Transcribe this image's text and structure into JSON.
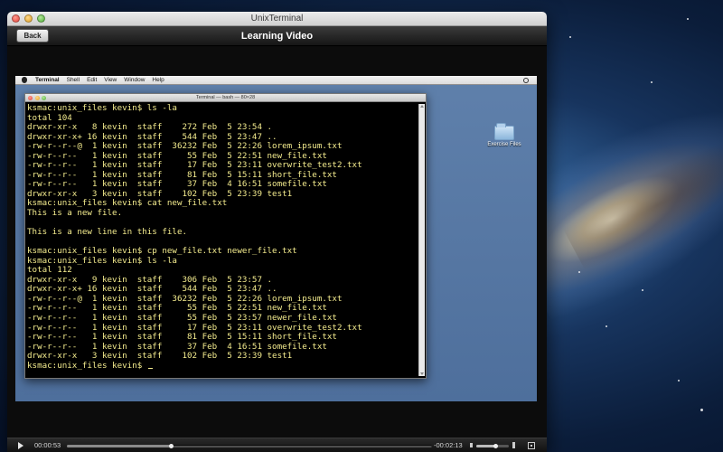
{
  "window": {
    "title": "UnixTerminal"
  },
  "navbar": {
    "back_label": "Back",
    "title": "Learning Video"
  },
  "video": {
    "menubar": {
      "app_name": "Terminal",
      "items": [
        "Shell",
        "Edit",
        "View",
        "Window",
        "Help"
      ]
    },
    "terminal": {
      "title": "Terminal — bash — 80×28",
      "lines": [
        "ksmac:unix_files kevin$ ls -la",
        "total 104",
        "drwxr-xr-x   8 kevin  staff    272 Feb  5 23:54 .",
        "drwxr-xr-x+ 16 kevin  staff    544 Feb  5 23:47 ..",
        "-rw-r--r--@  1 kevin  staff  36232 Feb  5 22:26 lorem_ipsum.txt",
        "-rw-r--r--   1 kevin  staff     55 Feb  5 22:51 new_file.txt",
        "-rw-r--r--   1 kevin  staff     17 Feb  5 23:11 overwrite_test2.txt",
        "-rw-r--r--   1 kevin  staff     81 Feb  5 15:11 short_file.txt",
        "-rw-r--r--   1 kevin  staff     37 Feb  4 16:51 somefile.txt",
        "drwxr-xr-x   3 kevin  staff    102 Feb  5 23:39 test1",
        "ksmac:unix_files kevin$ cat new_file.txt",
        "This is a new file.",
        "",
        "This is a new line in this file.",
        "",
        "ksmac:unix_files kevin$ cp new_file.txt newer_file.txt",
        "ksmac:unix_files kevin$ ls -la",
        "total 112",
        "drwxr-xr-x   9 kevin  staff    306 Feb  5 23:57 .",
        "drwxr-xr-x+ 16 kevin  staff    544 Feb  5 23:47 ..",
        "-rw-r--r--@  1 kevin  staff  36232 Feb  5 22:26 lorem_ipsum.txt",
        "-rw-r--r--   1 kevin  staff     55 Feb  5 22:51 new_file.txt",
        "-rw-r--r--   1 kevin  staff     55 Feb  5 23:57 newer_file.txt",
        "-rw-r--r--   1 kevin  staff     17 Feb  5 23:11 overwrite_test2.txt",
        "-rw-r--r--   1 kevin  staff     81 Feb  5 15:11 short_file.txt",
        "-rw-r--r--   1 kevin  staff     37 Feb  4 16:51 somefile.txt",
        "drwxr-xr-x   3 kevin  staff    102 Feb  5 23:39 test1",
        "ksmac:unix_files kevin$ "
      ],
      "text_color": "#f4ec8e",
      "background": "#000000"
    },
    "desktop_folder_label": "Exercise Files"
  },
  "controls": {
    "elapsed": "00:00:53",
    "remaining": "-00:02:13",
    "progress_fraction": 0.285,
    "volume_fraction": 0.6,
    "icons": [
      "play-icon",
      "volume-low-icon",
      "volume-high-icon",
      "fullscreen-icon"
    ]
  }
}
